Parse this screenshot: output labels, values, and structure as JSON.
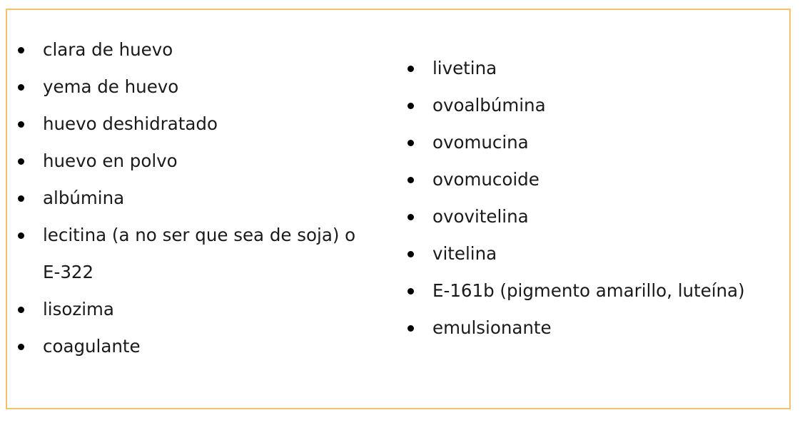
{
  "left_list": [
    "clara de huevo",
    "yema de huevo",
    "huevo deshidratado",
    "huevo en polvo",
    "albúmina",
    "lecitina (a no ser que sea de soja) o E-322",
    "lisozima",
    "coagulante"
  ],
  "right_list": [
    "livetina",
    "ovoalbúmina",
    "ovomucina",
    "ovomucoide",
    "ovovitelina",
    "vitelina",
    "E-161b (pigmento amarillo, luteína)",
    "emulsionante"
  ],
  "colors": {
    "border": "#f5c26b",
    "text": "#1a1a1a",
    "bullet": "#000000"
  },
  "icons": [
    "bullet-icon"
  ]
}
